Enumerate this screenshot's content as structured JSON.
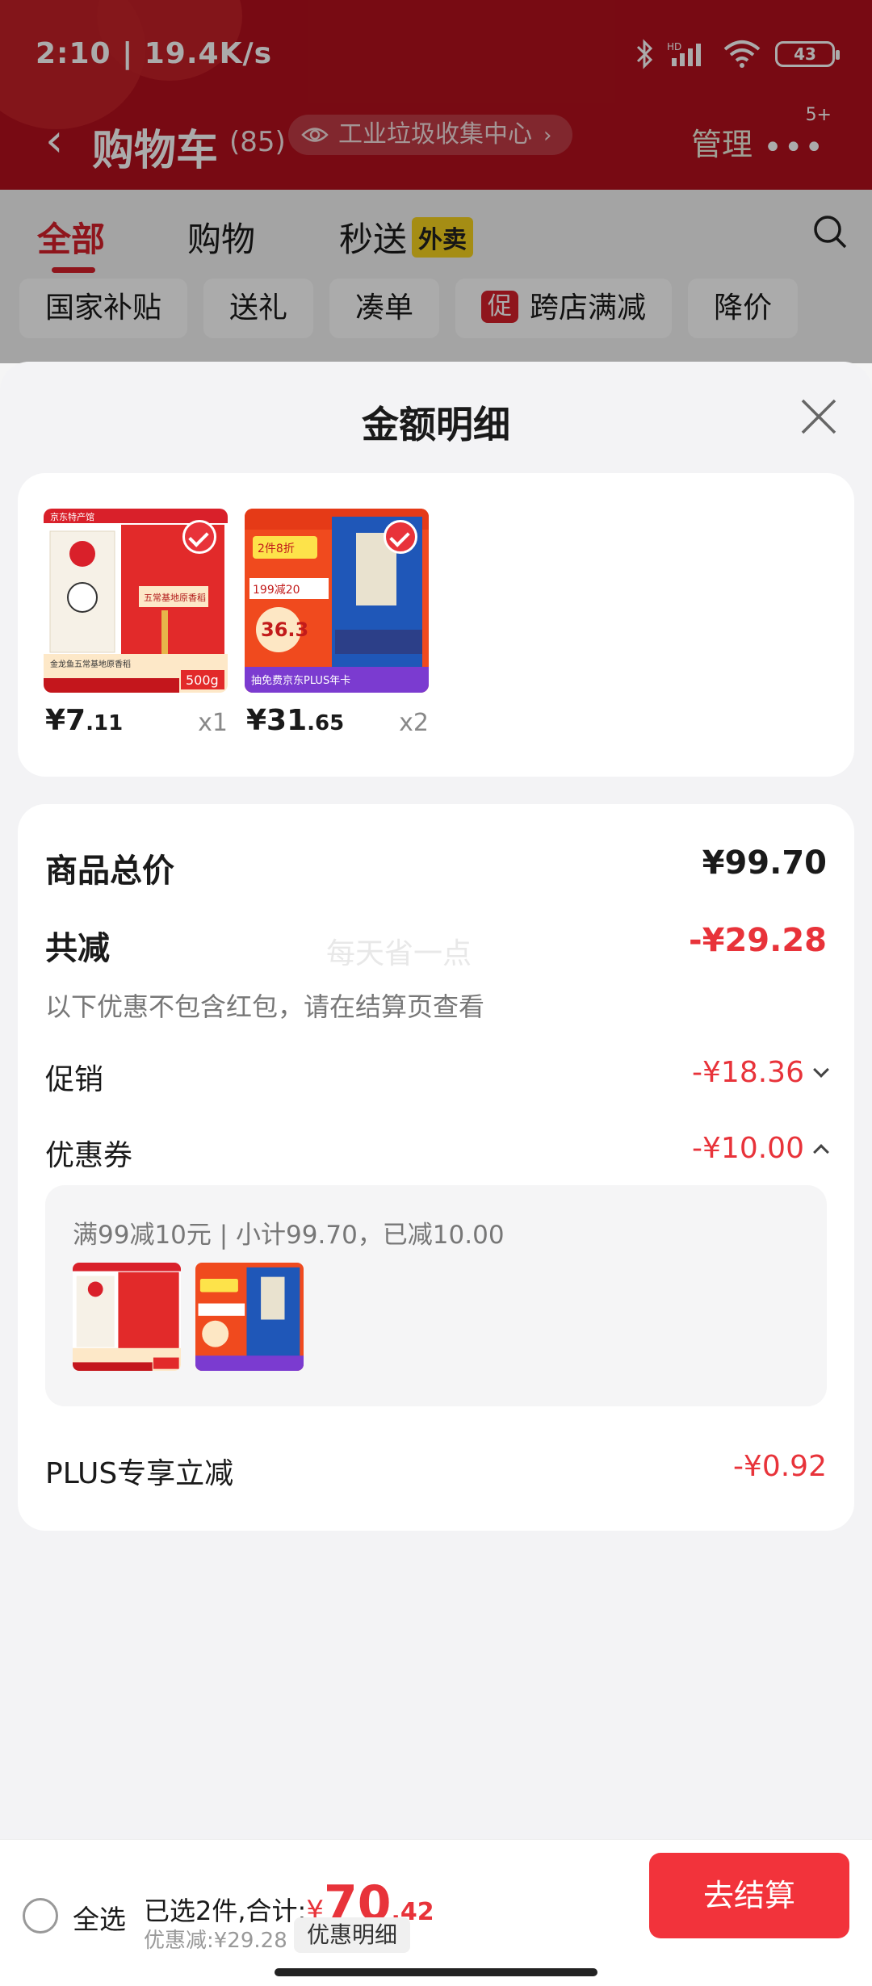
{
  "status": {
    "time": "2:10 | 19.4K/s",
    "battery": "43"
  },
  "header": {
    "title": "购物车",
    "count": "(85)",
    "location": "工业垃圾收集中心",
    "manage": "管理",
    "more_badge": "5+"
  },
  "tabs": [
    {
      "label": "全部",
      "active": true
    },
    {
      "label": "购物"
    },
    {
      "label": "秒送",
      "badge": "外卖"
    }
  ],
  "filter_chips": [
    "国家补贴",
    "送礼",
    "凑单",
    "跨店满减",
    "降价"
  ],
  "chip_promo_badge": "促",
  "sheet": {
    "title": "金额明细",
    "products": [
      {
        "price_int": "¥7",
        "price_dec": ".11",
        "qty": "x1"
      },
      {
        "price_int": "¥31",
        "price_dec": ".65",
        "qty": "x2"
      }
    ],
    "product_image_text": {
      "p1_top": "京东特产馆",
      "p1_mid": "五常基地原香稻",
      "p1_bottom": "金龙鱼五常基地原香稻",
      "p1_weight": "500g",
      "p2_top": "2件8折",
      "p2_mid": "199减20",
      "p2_price": "36.3",
      "p2_bottom": "抽免费京东PLUS年卡"
    },
    "summary": {
      "total_label": "商品总价",
      "total_value": "¥99.70",
      "reduce_label": "共减",
      "reduce_value": "-¥29.28",
      "watermark": "每天省一点",
      "note": "以下优惠不包含红包，请在结算页查看",
      "promo_label": "促销",
      "promo_value": "-¥18.36",
      "coupon_label": "优惠券",
      "coupon_value": "-¥10.00",
      "coupon_desc": "满99减10元 | 小计99.70，已减10.00",
      "plus_label": "PLUS专享立减",
      "plus_value": "-¥0.92"
    }
  },
  "bottom": {
    "select_all": "全选",
    "selected": "已选2件,合计:",
    "yen": "¥",
    "total_int": "70",
    "total_dec": ".42",
    "discount": "优惠减:¥29.28",
    "detail": "优惠明细",
    "checkout": "去结算"
  },
  "colors": {
    "brand_red": "#e8333a",
    "header_red": "#b3101d"
  }
}
